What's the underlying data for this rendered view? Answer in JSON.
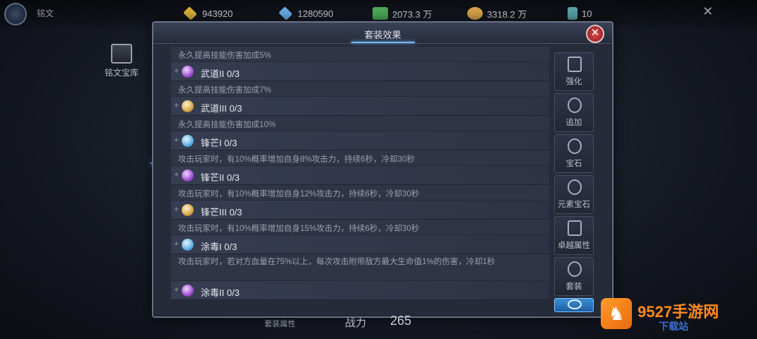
{
  "topbar": {
    "back_label": "铭文",
    "resources": [
      {
        "icon": "yellow-diamond-icon",
        "value": "943920",
        "color": "#d9b23a"
      },
      {
        "icon": "blue-diamond-icon",
        "value": "1280590",
        "color": "#6aa8e6"
      },
      {
        "icon": "green-dragon-icon",
        "value": "2073.3 万",
        "color": "#4ea85a"
      },
      {
        "icon": "gold-coin-icon",
        "value": "3318.2 万",
        "color": "#d7a349"
      },
      {
        "icon": "teal-potion-icon",
        "value": "10",
        "color": "#59a3a9"
      }
    ],
    "close_glyph": "✕"
  },
  "sidebar": {
    "treasury_label": "铭文宝库"
  },
  "panel": {
    "title": "套装效果",
    "close_glyph": "✕",
    "rows": [
      {
        "kind": "desc",
        "text": "永久提高技能伤害加成5%"
      },
      {
        "kind": "item",
        "gem": "purple",
        "name": "武道II 0/3"
      },
      {
        "kind": "desc",
        "text": "永久提高技能伤害加成7%"
      },
      {
        "kind": "item",
        "gem": "gold",
        "name": "武道III 0/3"
      },
      {
        "kind": "desc",
        "text": "永久提高技能伤害加成10%"
      },
      {
        "kind": "item",
        "gem": "blue",
        "name": "锋芒I 0/3"
      },
      {
        "kind": "desc",
        "text": "攻击玩家时，有10%概率增加自身8%攻击力，持续6秒，冷却30秒"
      },
      {
        "kind": "item",
        "gem": "purple",
        "name": "锋芒II 0/3"
      },
      {
        "kind": "desc",
        "text": "攻击玩家时，有10%概率增加自身12%攻击力，持续6秒，冷却30秒"
      },
      {
        "kind": "item",
        "gem": "gold",
        "name": "锋芒III 0/3"
      },
      {
        "kind": "desc",
        "text": "攻击玩家时，有10%概率增加自身15%攻击力，持续6秒，冷却30秒"
      },
      {
        "kind": "item",
        "gem": "blue",
        "name": "涂毒I 0/3"
      },
      {
        "kind": "desc_tall",
        "text": "攻击玩家时，若对方血量在75%以上，每次攻击附带敌方最大生命值1%的伤害，冷却1秒"
      },
      {
        "kind": "item",
        "gem": "purple",
        "name": "涂毒II 0/3"
      }
    ],
    "tabs": [
      {
        "label": "强化",
        "icon": "anvil-icon"
      },
      {
        "label": "追加",
        "icon": "add-sigil-icon"
      },
      {
        "label": "宝石",
        "icon": "gem-sigil-icon"
      },
      {
        "label": "元素宝石",
        "icon": "element-gem-icon"
      },
      {
        "label": "卓越属性",
        "icon": "excellence-icon"
      },
      {
        "label": "套装",
        "icon": "suit-icon"
      },
      {
        "label": "",
        "icon": "inscription-icon",
        "active": true
      }
    ]
  },
  "bottom": {
    "suit_label": "套装属性",
    "power_label": "战力",
    "power_value": "265"
  },
  "watermark": {
    "text": "9527手游网",
    "sub": "下载站"
  }
}
